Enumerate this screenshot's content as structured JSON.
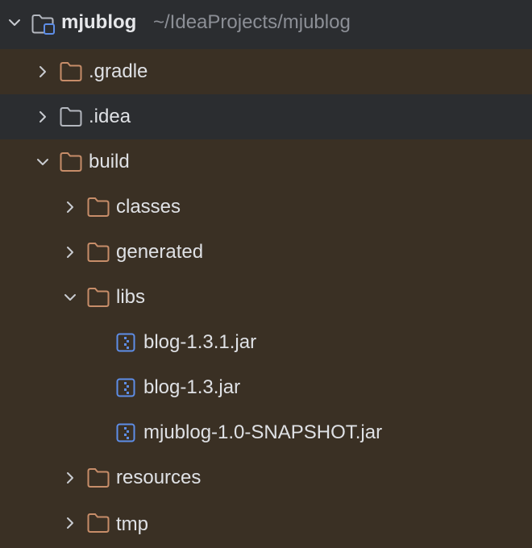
{
  "project": {
    "name": "mjublog",
    "path": "~/IdeaProjects/mjublog",
    "expanded": true,
    "icon": "project-folder-icon"
  },
  "nodes": [
    {
      "key": "gradle",
      "label": ".gradle",
      "type": "folder",
      "expanded": false,
      "icon": "folder-icon"
    },
    {
      "key": "idea",
      "label": ".idea",
      "type": "folder",
      "expanded": false,
      "icon": "folder-icon"
    },
    {
      "key": "build",
      "label": "build",
      "type": "folder",
      "expanded": true,
      "icon": "folder-icon"
    },
    {
      "key": "classes",
      "label": "classes",
      "type": "folder",
      "expanded": false,
      "icon": "folder-icon"
    },
    {
      "key": "generated",
      "label": "generated",
      "type": "folder",
      "expanded": false,
      "icon": "folder-icon"
    },
    {
      "key": "libs",
      "label": "libs",
      "type": "folder",
      "expanded": true,
      "icon": "folder-icon"
    },
    {
      "key": "blog131",
      "label": "blog-1.3.1.jar",
      "type": "jar",
      "icon": "jar-archive-icon"
    },
    {
      "key": "blog13",
      "label": "blog-1.3.jar",
      "type": "jar",
      "icon": "jar-archive-icon"
    },
    {
      "key": "snapshot",
      "label": "mjublog-1.0-SNAPSHOT.jar",
      "type": "jar",
      "icon": "jar-archive-icon"
    },
    {
      "key": "resources",
      "label": "resources",
      "type": "folder",
      "expanded": false,
      "icon": "folder-icon"
    },
    {
      "key": "tmp",
      "label": "tmp",
      "type": "folder",
      "expanded": false,
      "icon": "folder-icon"
    }
  ],
  "colors": {
    "background": "#3a3024",
    "idea_row": "#2b2d30",
    "folder_excluded": "#c78d69",
    "folder_plain": "#b4b8bf",
    "jar": "#5e8ee8",
    "text": "#dfe1e5",
    "path_text": "#8c8f96"
  }
}
